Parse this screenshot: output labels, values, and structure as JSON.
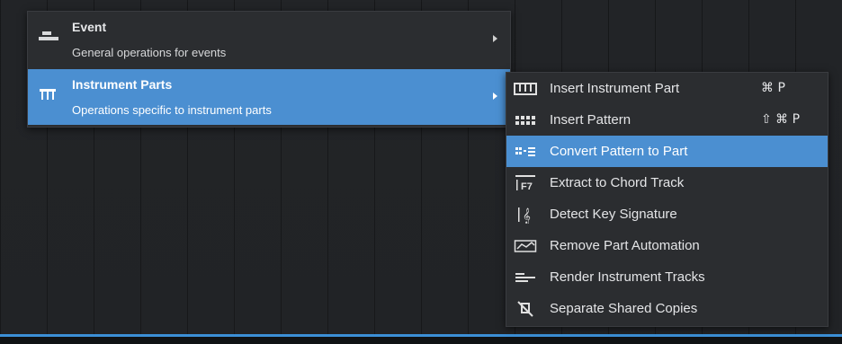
{
  "main_menu": {
    "items": [
      {
        "title": "Event",
        "description": "General operations for events",
        "icon": "event-icon"
      },
      {
        "title": "Instrument Parts",
        "description": "Operations specific to instrument parts",
        "icon": "instrument-parts-icon"
      }
    ]
  },
  "submenu": {
    "items": [
      {
        "label": "Insert Instrument Part",
        "shortcut": "⌘ P",
        "icon": "piano-keys-icon"
      },
      {
        "label": "Insert Pattern",
        "shortcut": "⇧ ⌘ P",
        "icon": "pattern-icon"
      },
      {
        "label": "Convert Pattern to Part",
        "shortcut": "",
        "icon": "convert-pattern-icon"
      },
      {
        "label": "Extract to Chord Track",
        "shortcut": "",
        "icon": "chord-track-icon"
      },
      {
        "label": "Detect Key Signature",
        "shortcut": "",
        "icon": "treble-clef-icon"
      },
      {
        "label": "Remove Part Automation",
        "shortcut": "",
        "icon": "automation-icon"
      },
      {
        "label": "Render Instrument Tracks",
        "shortcut": "",
        "icon": "render-tracks-icon"
      },
      {
        "label": "Separate Shared Copies",
        "shortcut": "",
        "icon": "separate-copies-icon"
      }
    ]
  },
  "icon_text": {
    "f7": "F7",
    "clef": "𝄞"
  },
  "colors": {
    "selection": "#4b8fd1",
    "menu_bg": "#2b2d30",
    "timeline_accent": "#3c8fd6"
  }
}
